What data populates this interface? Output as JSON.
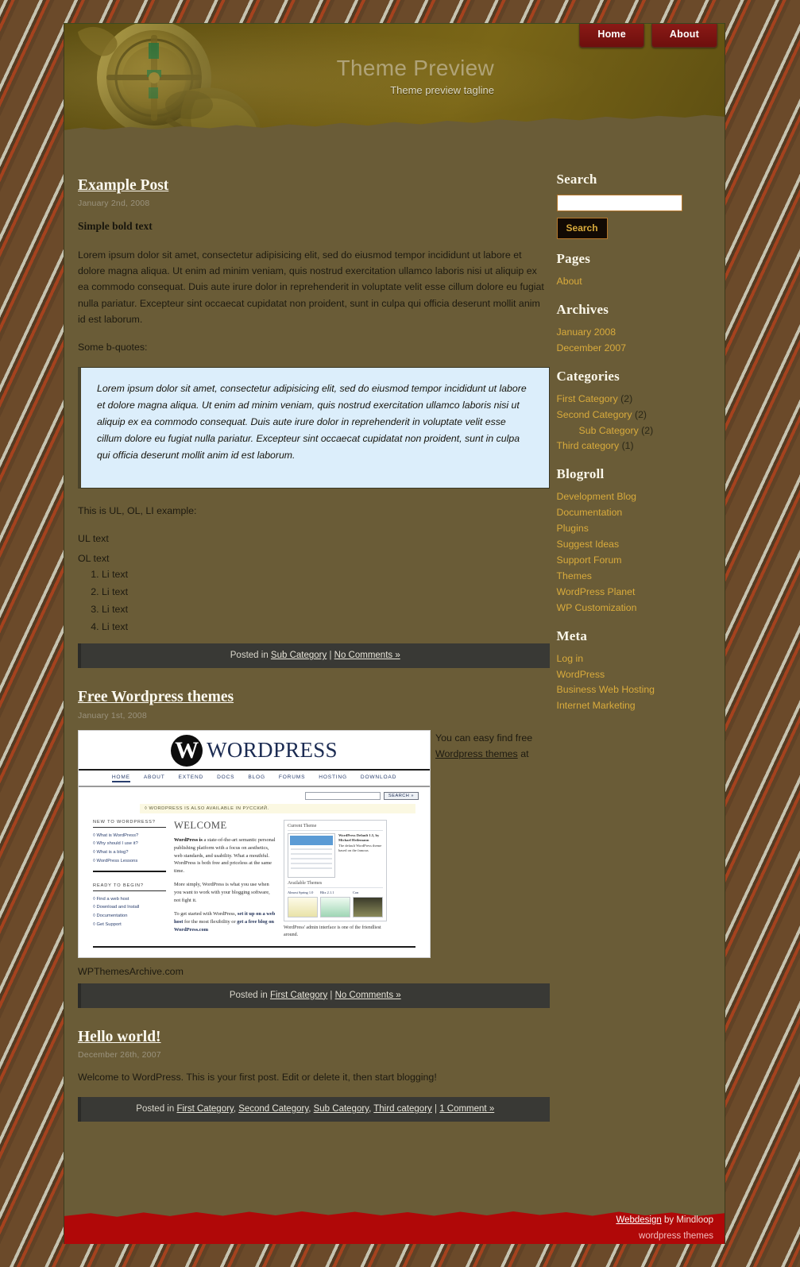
{
  "site": {
    "title": "Theme Preview",
    "tagline": "Theme preview tagline"
  },
  "nav": {
    "items": [
      {
        "label": "Home"
      },
      {
        "label": "About"
      }
    ]
  },
  "posts": [
    {
      "title": "Example Post",
      "date": "January 2nd, 2008",
      "bold_intro": "Simple bold text",
      "paragraph": "Lorem ipsum dolor sit amet, consectetur adipisicing elit, sed do eiusmod tempor incididunt ut labore et dolore magna aliqua. Ut enim ad minim veniam, quis nostrud exercitation ullamco laboris nisi ut aliquip ex ea commodo consequat. Duis aute irure dolor in reprehenderit in voluptate velit esse cillum dolore eu fugiat nulla pariatur. Excepteur sint occaecat cupidatat non proident, sunt in culpa qui officia deserunt mollit anim id est laborum.",
      "bquote_lead": "Some b-quotes:",
      "blockquote": "Lorem ipsum dolor sit amet, consectetur adipisicing elit, sed do eiusmod tempor incididunt ut labore et dolore magna aliqua. Ut enim ad minim veniam, quis nostrud exercitation ullamco laboris nisi ut aliquip ex ea commodo consequat. Duis aute irure dolor in reprehenderit in voluptate velit esse cillum dolore eu fugiat nulla pariatur. Excepteur sint occaecat cupidatat non proident, sunt in culpa qui officia deserunt mollit anim id est laborum.",
      "list_lead": "This is UL, OL, LI example:",
      "ul_item": "UL text",
      "ol_item": "OL text",
      "ol_items": [
        "Li text",
        "Li text",
        "Li text",
        "Li text"
      ],
      "meta_prefix": "Posted in",
      "meta_categories": [
        "Sub Category"
      ],
      "meta_separator": "|",
      "meta_comments": "No Comments »"
    },
    {
      "title": "Free Wordpress themes",
      "date": "January 1st, 2008",
      "side_text_before": "You can easy find free",
      "side_link": "Wordpress themes",
      "side_text_after": "at",
      "caption": "WPThemesArchive.com",
      "meta_prefix": "Posted in",
      "meta_categories": [
        "First Category"
      ],
      "meta_separator": "|",
      "meta_comments": "No Comments »"
    },
    {
      "title": "Hello world!",
      "date": "December 26th, 2007",
      "paragraph": "Welcome to WordPress. This is your first post. Edit or delete it, then start blogging!",
      "meta_prefix": "Posted in",
      "meta_categories": [
        "First Category",
        "Second Category",
        "Sub Category",
        "Third category"
      ],
      "meta_separator": "|",
      "meta_comments": "1 Comment »"
    }
  ],
  "wp_screenshot": {
    "brand": "WORDPRESS",
    "logo_letter": "W",
    "nav": [
      "HOME",
      "ABOUT",
      "EXTEND",
      "DOCS",
      "BLOG",
      "FORUMS",
      "HOSTING",
      "DOWNLOAD"
    ],
    "search_button": "SEARCH »",
    "notice": "◊ WORDPRESS IS ALSO AVAILABLE IN РУССКИЙ.",
    "left_heading_1": "NEW TO WORDPRESS?",
    "left_items_1": [
      "◊ What is WordPress?",
      "◊ Why should I use it?",
      "◊ What is a blog?",
      "◊ WordPress Lessons"
    ],
    "left_heading_2": "READY TO BEGIN?",
    "left_items_2": [
      "◊ Find a web host",
      "◊ Download and Install",
      "◊ Documentation",
      "◊ Get Support"
    ],
    "welcome_heading": "WELCOME",
    "welcome_p1_bold": "WordPress is",
    "welcome_p1": "a state-of-the-art semantic personal publishing platform with a focus on aesthetics, web standards, and usability. What a mouthful. WordPress is both free and priceless at the same time.",
    "welcome_p2": "More simply, WordPress is what you use when you want to work with your blogging software, not fight it.",
    "welcome_p3_lead": "To get started with WordPress,",
    "welcome_p3_link1": "set it up on a web host",
    "welcome_p3_mid": "for the most flexibility or",
    "welcome_p3_link2": "get a free blog on WordPress.com",
    "panel_title": "Current Theme",
    "panel_theme_name": "WordPress Default 1.5, by Michael Heilemann",
    "panel_theme_desc": "The default WordPress theme based on the famous",
    "available_title": "Available Themes",
    "available_items": [
      "Almost Spring 1.0",
      "Blix 2.1.1",
      "Con"
    ],
    "panel_caption": "WordPress' admin interface is one of the friendliest around."
  },
  "sidebar": {
    "search": {
      "heading": "Search",
      "value": "",
      "placeholder": "",
      "button": "Search"
    },
    "pages": {
      "heading": "Pages",
      "items": [
        {
          "label": "About"
        }
      ]
    },
    "archives": {
      "heading": "Archives",
      "items": [
        {
          "label": "January 2008"
        },
        {
          "label": "December 2007"
        }
      ]
    },
    "categories": {
      "heading": "Categories",
      "items": [
        {
          "label": "First Category",
          "count": "(2)",
          "child": false
        },
        {
          "label": "Second Category",
          "count": "(2)",
          "child": false
        },
        {
          "label": "Sub Category",
          "count": "(2)",
          "child": true
        },
        {
          "label": "Third category",
          "count": "(1)",
          "child": false
        }
      ]
    },
    "blogroll": {
      "heading": "Blogroll",
      "items": [
        {
          "label": "Development Blog"
        },
        {
          "label": "Documentation"
        },
        {
          "label": "Plugins"
        },
        {
          "label": "Suggest Ideas"
        },
        {
          "label": "Support Forum"
        },
        {
          "label": "Themes"
        },
        {
          "label": "WordPress Planet"
        },
        {
          "label": "WP Customization"
        }
      ]
    },
    "meta": {
      "heading": "Meta",
      "items": [
        {
          "label": "Log in"
        },
        {
          "label": "WordPress"
        },
        {
          "label": "Business Web Hosting"
        },
        {
          "label": "Internet Marketing"
        }
      ]
    }
  },
  "footer": {
    "credit_link": "Webdesign",
    "credit_rest": " by Mindloop",
    "credit2": "wordpress themes"
  },
  "colors": {
    "page_bg": "#6a5c37",
    "nav_button": "#7d1412",
    "sidebar_link": "#d9ab3c",
    "blockquote_bg": "#dceefb",
    "meta_bar": "#393935",
    "footer_red": "#b00808"
  }
}
